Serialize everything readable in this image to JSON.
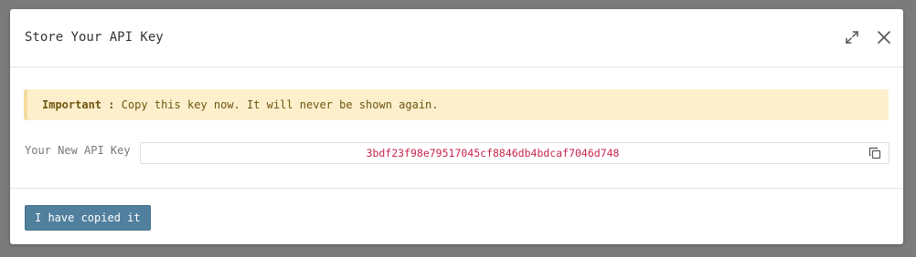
{
  "modal": {
    "title": "Store Your API Key",
    "expand_icon": "expand-icon",
    "close_icon": "close-icon"
  },
  "alert": {
    "strong": "Important :",
    "message": "Copy this key now. It will never be shown again."
  },
  "field": {
    "label": "Your New API Key",
    "value": "3bdf23f98e79517045cf8846db4bdcaf7046d748",
    "copy_icon": "copy-icon"
  },
  "footer": {
    "confirm_label": "I have copied it"
  },
  "colors": {
    "backdrop": "#7b7b7b",
    "alert_bg": "#fdefcc",
    "alert_border": "#f4dc9d",
    "key_text": "#c7254e",
    "primary_button": "#50809e"
  }
}
